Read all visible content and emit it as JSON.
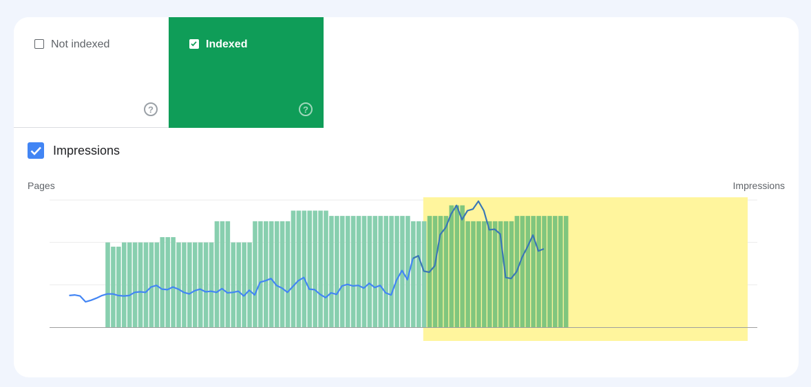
{
  "tabs": {
    "not_indexed": {
      "label": "Not indexed",
      "checked": false
    },
    "indexed": {
      "label": "Indexed",
      "checked": true
    }
  },
  "impressions_toggle": {
    "label": "Impressions",
    "checked": true
  },
  "colors": {
    "page_bg": "#f1f5fd",
    "indexed_green": "#0f9d58",
    "bar_green": "#88cfaf",
    "bar_green_highlighted": "#80c67e",
    "impressions_line": "#4285f4",
    "impressions_line_highlighted": "#3a77b5",
    "highlight": "#fff59d"
  },
  "icons": {
    "help": "question-circle-icon",
    "check": "checkmark-icon"
  },
  "chart_data": {
    "type": "bar",
    "ylabel_left": "Pages",
    "ylabel_right": "Impressions",
    "grid": true,
    "highlight_range": [
      63,
      88
    ],
    "series": [
      {
        "axis": "left",
        "type": "bar",
        "values": [
          0,
          0,
          0,
          0,
          80,
          76,
          76,
          80,
          80,
          80,
          80,
          80,
          80,
          80,
          85,
          85,
          85,
          80,
          80,
          80,
          80,
          80,
          80,
          80,
          100,
          100,
          100,
          80,
          80,
          80,
          80,
          100,
          100,
          100,
          100,
          100,
          100,
          100,
          110,
          110,
          110,
          110,
          110,
          110,
          110,
          105,
          105,
          105,
          105,
          105,
          105,
          105,
          105,
          105,
          105,
          105,
          105,
          105,
          105,
          105,
          100,
          100,
          100,
          105,
          105,
          105,
          105,
          115,
          115,
          115,
          100,
          100,
          100,
          100,
          100,
          100,
          100,
          100,
          100,
          105,
          105,
          105,
          105,
          105,
          105,
          105,
          105,
          105,
          105
        ]
      },
      {
        "axis": "right",
        "type": "line",
        "values": [
          15,
          15.5,
          14.5,
          9,
          10.5,
          12.5,
          15,
          16.5,
          16.5,
          15,
          14.5,
          15,
          18,
          18.5,
          18,
          23,
          24.5,
          21,
          20.5,
          23,
          21,
          18,
          16.5,
          19.5,
          21,
          18.5,
          19,
          18,
          21.5,
          17.5,
          18,
          19,
          14.5,
          20,
          15.5,
          27.5,
          29,
          31,
          24.5,
          22,
          18,
          23.5,
          29,
          32,
          21,
          20.5,
          16,
          13,
          17.5,
          16,
          24,
          25.5,
          24,
          24.5,
          22,
          26.5,
          22.5,
          24.5,
          17.5,
          15.5,
          29.5,
          38.5,
          30,
          50,
          52.5,
          38,
          37,
          43,
          72.5,
          79,
          92,
          100,
          86.5,
          95,
          96.5,
          104,
          95,
          77,
          77.5,
          73,
          32,
          31,
          37.5,
          51,
          61,
          72,
          57,
          59
        ]
      }
    ]
  }
}
